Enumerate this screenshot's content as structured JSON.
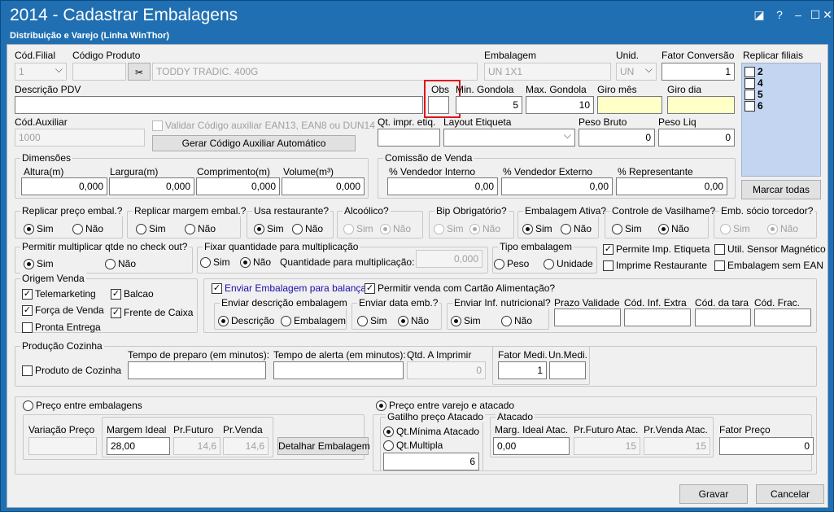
{
  "window": {
    "title": "2014 - Cadastrar Embalagens",
    "subtitle": "Distribuição e Varejo (Linha WinThor)"
  },
  "top": {
    "cod_filial_label": "Cód.Filial",
    "cod_filial_value": "1",
    "cod_produto_label": "Código Produto",
    "produto_desc": "TODDY TRADIC. 400G",
    "embalagem_label": "Embalagem",
    "embalagem_value": "UN 1X1",
    "unid_label": "Unid.",
    "unid_value": "UN",
    "fator_label": "Fator Conversão",
    "fator_value": "1",
    "replicar_label": "Replicar filiais"
  },
  "filiais": [
    "2",
    "4",
    "5",
    "6"
  ],
  "marcar_todas": "Marcar todas",
  "row2": {
    "descricao_label": "Descrição PDV",
    "descricao_value": "",
    "obs_label": "Obs",
    "min_label": "Min. Gondola",
    "min_value": "5",
    "max_label": "Max. Gondola",
    "max_value": "10",
    "giro_mes_label": "Giro mês",
    "giro_dia_label": "Giro dia"
  },
  "row3": {
    "cod_aux_label": "Cód.Auxiliar",
    "cod_aux_value": "1000",
    "validar_label": "Validar Código auxiliar EAN13, EAN8 ou DUN14",
    "gerar_button": "Gerar Código Auxiliar Automático",
    "qt_impr_label": "Qt. impr. etiq.",
    "layout_label": "Layout Etiqueta",
    "peso_bruto_label": "Peso Bruto",
    "peso_bruto_value": "0",
    "peso_liq_label": "Peso Liq",
    "peso_liq_value": "0"
  },
  "dimensoes": {
    "title": "Dimensões",
    "altura_label": "Altura(m)",
    "altura_value": "0,000",
    "largura_label": "Largura(m)",
    "largura_value": "0,000",
    "comprimento_label": "Comprimento(m)",
    "comprimento_value": "0,000",
    "volume_label": "Volume(m³)",
    "volume_value": "0,000"
  },
  "comissao": {
    "title": "Comissão de Venda",
    "vi_label": "% Vendedor Interno",
    "vi_value": "0,00",
    "ve_label": "% Vendedor Externo",
    "ve_value": "0,00",
    "rep_label": "% Representante",
    "rep_value": "0,00"
  },
  "radio_sim": "Sim",
  "radio_nao": "Não",
  "groups": {
    "replicar_preco": "Replicar preço embal.?",
    "replicar_margem": "Replicar margem embal.?",
    "usa_restaurante": "Usa restaurante?",
    "alcoolico": "Alcoólico?",
    "bip": "Bip Obrigatório?",
    "emb_ativa": "Embalagem Ativa?",
    "vasilhame": "Controle de Vasilhame?",
    "socio": "Emb. sócio torcedor?",
    "multiplicar": "Permitir multiplicar qtde no check out?",
    "fixar": "Fixar quantidade para multiplicação",
    "qtd_mult_label": "Quantidade para multiplicação:",
    "qtd_mult_value": "0,000",
    "tipo_emb": "Tipo embalagem",
    "peso": "Peso",
    "unidade": "Unidade"
  },
  "checks": {
    "permite_imp": "Permite Imp. Etiqueta",
    "sensor": "Util. Sensor Magnético",
    "imprime_rest": "Imprime Restaurante",
    "sem_ean": "Embalagem sem EAN"
  },
  "origem": {
    "title": "Origem Venda",
    "telemarketing": "Telemarketing",
    "balcao": "Balcao",
    "forca": "Força de Venda",
    "frente": "Frente de Caixa",
    "pronta": "Pronta Entrega"
  },
  "balanca": {
    "enviar": "Enviar Embalagem para balança",
    "cartao": "Permitir venda com Cartão Alimentação?",
    "desc_title": "Enviar descrição embalagem",
    "descricao": "Descrição",
    "embalagem": "Embalagem",
    "data_title": "Enviar data emb.?",
    "inf_title": "Enviar Inf. nutricional?",
    "prazo": "Prazo Validade",
    "inf_extra": "Cód. Inf. Extra",
    "tara": "Cód. da tara",
    "frac": "Cód. Frac."
  },
  "cozinha": {
    "title": "Produção Cozinha",
    "produto": "Produto de Cozinha",
    "preparo": "Tempo de preparo (em minutos):",
    "alerta": "Tempo de alerta (em minutos):",
    "qtd_label": "Qtd. A Imprimir",
    "qtd_value": "0",
    "fator_label": "Fator Medi.",
    "fator_value": "1",
    "un_label": "Un.Medi."
  },
  "preco": {
    "entre_emb": "Preço entre embalagens",
    "variacao": "Variação Preço",
    "margem_label": "Margem Ideal",
    "margem_value": "28,00",
    "futuro_label": "Pr.Futuro",
    "futuro_value": "14,6",
    "venda_label": "Pr.Venda",
    "venda_value": "14,6",
    "detalhar": "Detalhar Embalagem",
    "varejo": "Preço entre varejo e atacado",
    "gatilho": "Gatilho preço Atacado",
    "qt_min": "Qt.Mínima Atacado",
    "qt_mult": "Qt.Multipla",
    "qt_mult_value": "6",
    "atacado": "Atacado",
    "marg_atac": "Marg. Ideal Atac.",
    "marg_atac_value": "0,00",
    "fut_atac": "Pr.Futuro Atac.",
    "fut_atac_value": "15",
    "venda_atac": "Pr.Venda Atac.",
    "venda_atac_value": "15",
    "fator_preco": "Fator Preço",
    "fator_preco_value": "0"
  },
  "buttons": {
    "gravar": "Gravar",
    "cancelar": "Cancelar"
  }
}
